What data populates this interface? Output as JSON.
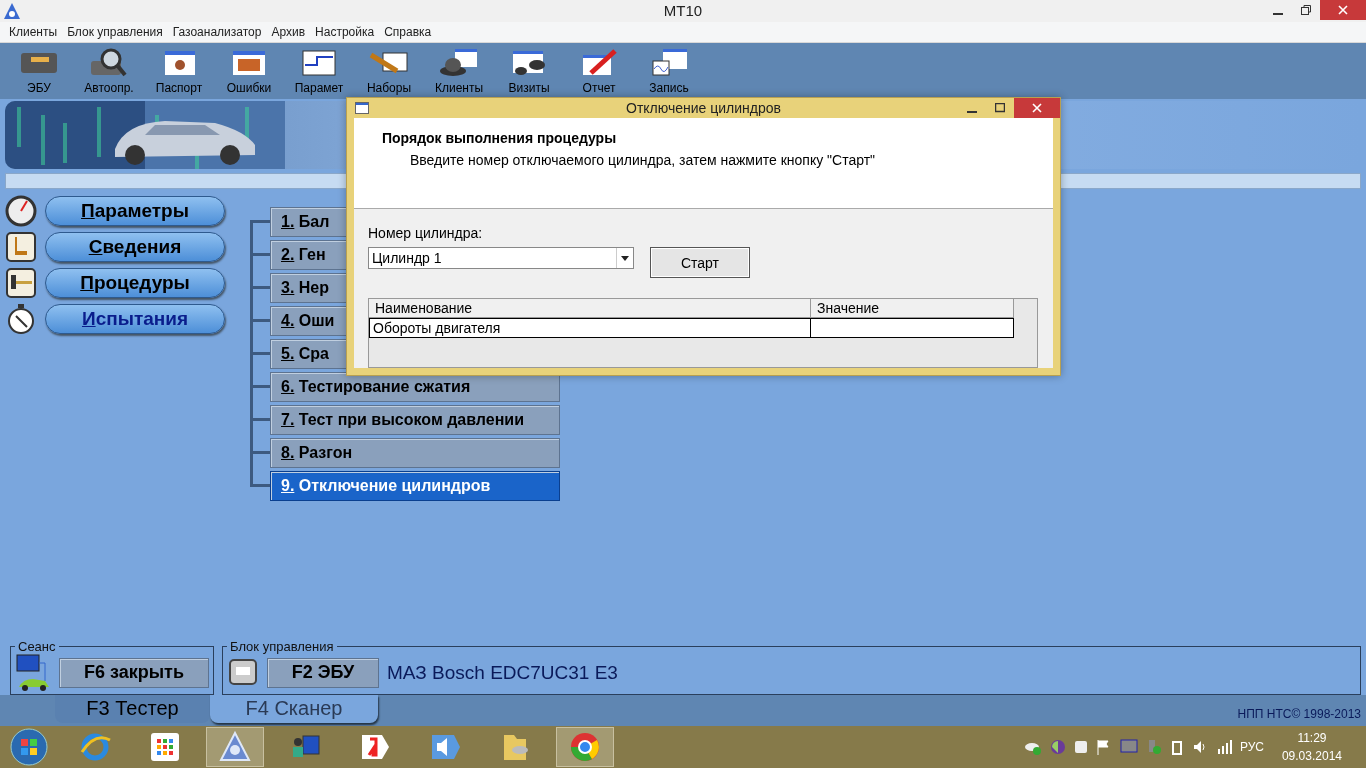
{
  "window": {
    "title": "MT10"
  },
  "menu": [
    "Клиенты",
    "Блок управления",
    "Газоанализатор",
    "Архив",
    "Настройка",
    "Справка"
  ],
  "toolbar": [
    {
      "kind": "ecu",
      "label": "ЭБУ"
    },
    {
      "kind": "autoscan",
      "label": "Автоопр."
    },
    {
      "kind": "passport",
      "label": "Паспорт"
    },
    {
      "kind": "errors",
      "label": "Ошибки"
    },
    {
      "kind": "params",
      "label": "Парамет"
    },
    {
      "kind": "sets",
      "label": "Наборы"
    },
    {
      "kind": "clients",
      "label": "Клиенты"
    },
    {
      "kind": "visits",
      "label": "Визиты"
    },
    {
      "kind": "report",
      "label": "Отчет"
    },
    {
      "kind": "record",
      "label": "Запись"
    }
  ],
  "nav": [
    {
      "kind": "gauge",
      "label": "Параметры",
      "selected": false
    },
    {
      "kind": "info",
      "label": "Сведения",
      "selected": false
    },
    {
      "kind": "tool",
      "label": "Процедуры",
      "selected": false
    },
    {
      "kind": "stopwatch",
      "label": "Испытания",
      "selected": true
    }
  ],
  "procedures": [
    {
      "label": "1. Бал",
      "selected": false
    },
    {
      "label": "2. Ген",
      "selected": false
    },
    {
      "label": "3. Нер",
      "selected": false
    },
    {
      "label": "4. Оши",
      "selected": false
    },
    {
      "label": "5. Сра",
      "selected": false
    },
    {
      "label": "6. Тестирование сжатия",
      "selected": false
    },
    {
      "label": "7. Тест при высоком давлении",
      "selected": false
    },
    {
      "label": "8. Разгон",
      "selected": false
    },
    {
      "label": "9. Отключение цилиндров",
      "selected": true
    }
  ],
  "session": {
    "legend": "Сеанс",
    "button": "F6 закрыть"
  },
  "ecu": {
    "legend": "Блок управления",
    "button": "F2 ЭБУ",
    "name": "МАЗ Bosch EDC7UC31 E3"
  },
  "tabs": [
    {
      "label": "F3 Тестер",
      "selected": false
    },
    {
      "label": "F4 Сканер",
      "selected": true
    }
  ],
  "copyright": "НПП НТС© 1998-2013",
  "dialog": {
    "title": "Отключение цилиндров",
    "heading": "Порядок выполнения процедуры",
    "instruction": "Введите номер отключаемого цилиндра, затем нажмите кнопку \"Старт\"",
    "field_label": "Номер цилиндра:",
    "cylinder": {
      "value": "Цилиндр 1"
    },
    "start_button": "Старт",
    "table": {
      "columns": [
        "Наименование",
        "Значение"
      ],
      "rows": [
        [
          "Обороты двигателя",
          ""
        ]
      ]
    }
  },
  "taskbar": {
    "apps": [
      {
        "kind": "ie",
        "selected": false
      },
      {
        "kind": "grid",
        "selected": false
      },
      {
        "kind": "mt",
        "selected": true
      },
      {
        "kind": "person",
        "selected": false
      },
      {
        "kind": "yandex",
        "selected": false
      },
      {
        "kind": "sound",
        "selected": false
      },
      {
        "kind": "folder",
        "selected": false
      },
      {
        "kind": "chrome",
        "selected": true
      }
    ],
    "language": "РУС",
    "time": "11:29",
    "date": "09.03.2014"
  }
}
